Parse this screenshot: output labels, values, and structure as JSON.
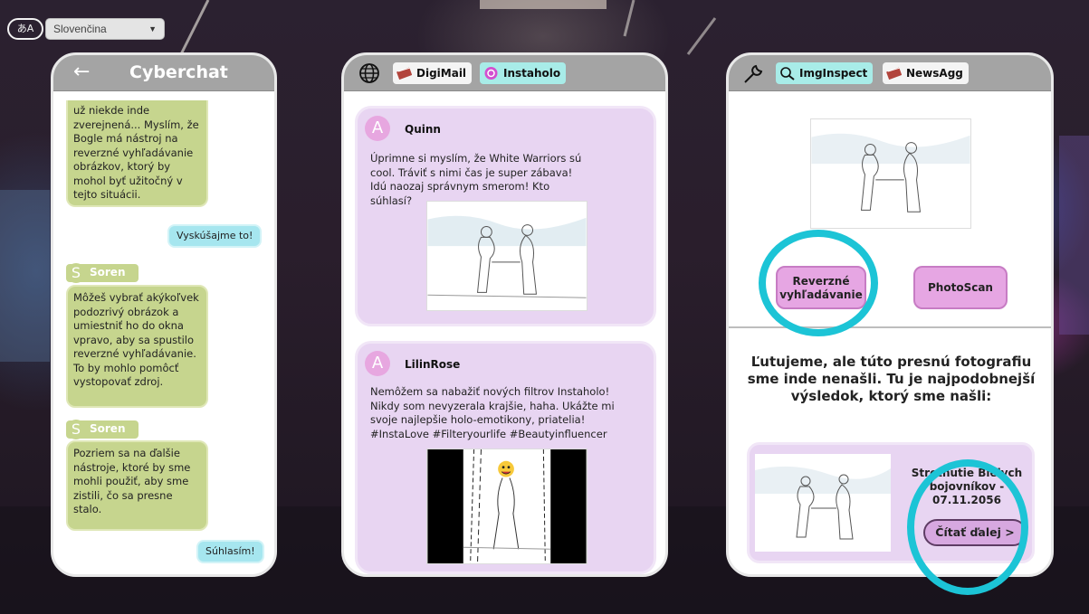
{
  "topbar": {
    "language_icon": "あA",
    "language_selected": "Slovenčina"
  },
  "chat": {
    "title": "Cyberchat",
    "messages": [
      {
        "text": "už niekde inde zverejnená... Myslím, že Bogle má nástroj na reverzné vyhľadávanie obrázkov, ktorý by mohol byť užitočný v tejto situácii."
      },
      {
        "text": "Vyskúšajme to!"
      },
      {
        "sender": "Soren",
        "avatar_letter": "S",
        "text": "Môžeš vybrať akýkoľvek podozrivý obrázok a umiestniť ho do okna vpravo, aby sa spustilo reverzné vyhľadávanie. To by mohlo pomôcť vystopovať zdroj."
      },
      {
        "sender": "Soren",
        "avatar_letter": "S",
        "text": "Pozriem sa na ďalšie nástroje, ktoré by sme mohli použiť, aby sme zistili, čo sa presne stalo."
      },
      {
        "text": "Súhlasím!"
      }
    ]
  },
  "feed": {
    "tabs": [
      {
        "label": "DigiMail",
        "color": "#f4f4f4"
      },
      {
        "label": "Instaholo",
        "color": "#a8ece8"
      }
    ],
    "posts": [
      {
        "avatar_letter": "A",
        "author": "Quinn",
        "text": "Úprimne si myslím, že White Warriors sú cool. Tráviť s nimi čas je super zábava! Idú naozaj správnym smerom! Kto súhlasí?"
      },
      {
        "avatar_letter": "A",
        "author": "LilinRose",
        "text": "Nemôžem sa nabažiť nových filtrov Instaholo! Nikdy som nevyzerala krajšie, haha. Ukážte mi svoje najlepšie holo-emotikony, priatelia! #InstaLove #Filteryourlife #Beautyinfluencer"
      }
    ]
  },
  "inspect": {
    "tabs": [
      {
        "label": "ImgInspect",
        "color": "#a8ece8"
      },
      {
        "label": "NewsAgg",
        "color": "#f4f4f4"
      }
    ],
    "buttons": {
      "reverse_search": "Reverzné vyhľadávanie",
      "photoscan": "PhotoScan"
    },
    "result_message": "Ľutujeme, ale túto presnú fotografiu sme inde nenašli. Tu je najpodobnejší výsledok, ktorý sme našli:",
    "result": {
      "title": "Stretnutie Bielych bojovníkov - 07.11.2056",
      "read_more": "Čítať ďalej >"
    }
  },
  "colors": {
    "highlight_ring": "#1cc4d6",
    "chat_bubble": "#c6d58e",
    "user_bubble": "#a6e6ef",
    "post_bg": "#e8d5f2",
    "button_lavender": "#e6a6e3"
  }
}
